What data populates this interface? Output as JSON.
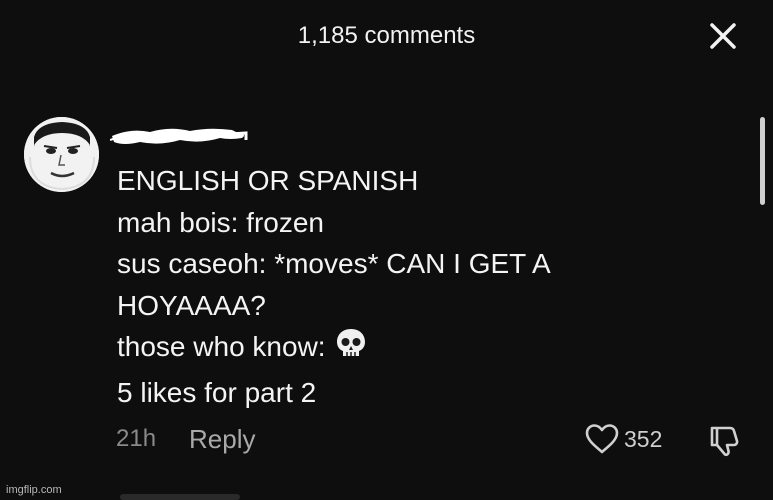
{
  "header": {
    "title": "1,185 comments",
    "close_icon": "close-icon"
  },
  "comment": {
    "avatar_icon": "face-avatar",
    "username_redacted": true,
    "lines": [
      "ENGLISH OR SPANISH",
      "mah bois: frozen",
      "sus caseoh: *moves* CAN I GET A",
      "HOYAAAA?",
      "those who know:",
      "5 likes for part 2"
    ],
    "emoji_icon": "skull-icon",
    "time": "21h",
    "reply_label": "Reply",
    "like_icon": "heart-icon",
    "like_count": "352",
    "dislike_icon": "thumbs-down-icon"
  },
  "watermark": "imgflip.com",
  "colors": {
    "background": "#0e0e0e",
    "text": "#f4f4f4",
    "muted": "#8a8a8a"
  }
}
